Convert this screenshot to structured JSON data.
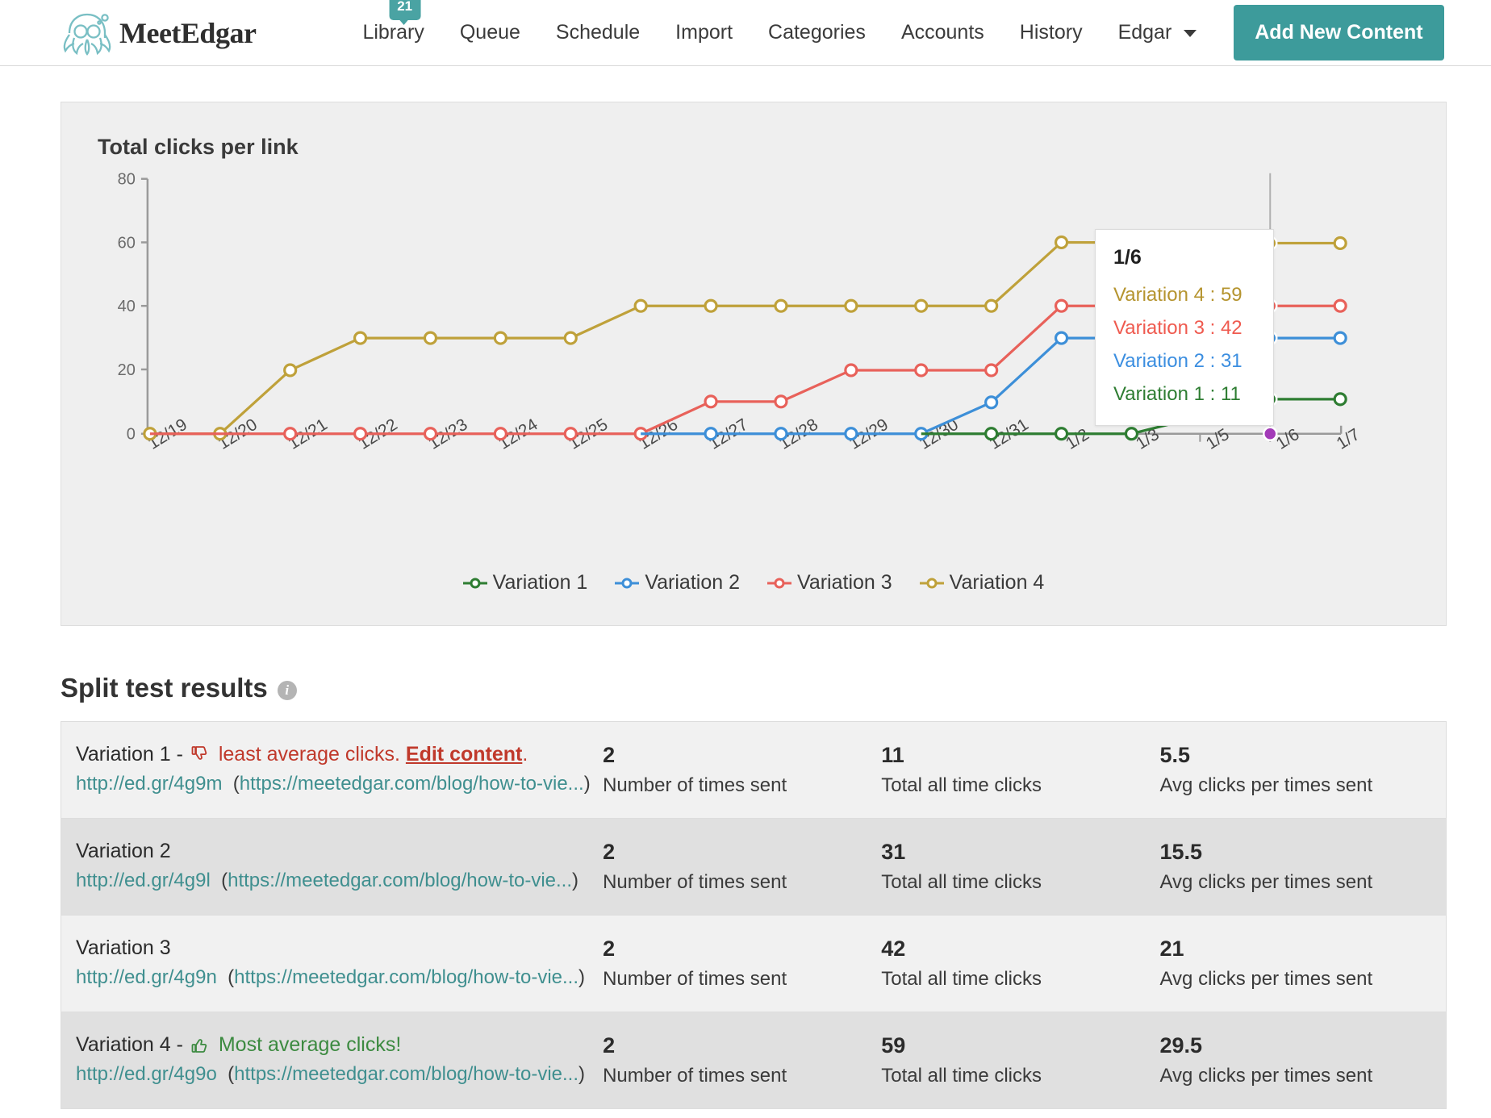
{
  "brand": {
    "name": "MeetEdgar",
    "logo_icon": "octopus-glasses-icon",
    "accent": "#3d9b9b"
  },
  "nav": {
    "items": [
      {
        "label": "Library",
        "badge": "21"
      },
      {
        "label": "Queue"
      },
      {
        "label": "Schedule"
      },
      {
        "label": "Import"
      },
      {
        "label": "Categories"
      },
      {
        "label": "Accounts"
      },
      {
        "label": "History"
      },
      {
        "label": "Edgar",
        "caret": true
      }
    ],
    "cta": "Add New Content"
  },
  "chart_card": {
    "title": "Total clicks per link"
  },
  "chart_data": {
    "type": "line",
    "title": "Total clicks per link",
    "xlabel": "",
    "ylabel": "",
    "ylim": [
      0,
      80
    ],
    "yticks": [
      0,
      20,
      40,
      60,
      80
    ],
    "grid": false,
    "legend_position": "bottom",
    "categories": [
      "12/19",
      "12/20",
      "12/21",
      "12/22",
      "12/23",
      "12/24",
      "12/25",
      "12/26",
      "12/27",
      "12/28",
      "12/29",
      "12/30",
      "12/31",
      "1/2",
      "1/3",
      "1/5",
      "1/6",
      "1/7"
    ],
    "series": [
      {
        "name": "Variation 1",
        "color": "#2e7d32",
        "values": [
          0,
          0,
          0,
          0,
          0,
          0,
          0,
          0,
          0,
          0,
          0,
          0,
          0,
          0,
          0,
          null,
          11,
          11
        ]
      },
      {
        "name": "Variation 2",
        "color": "#3d8fd8",
        "values": [
          0,
          0,
          0,
          0,
          0,
          0,
          0,
          0,
          0,
          0,
          0,
          0,
          10,
          30,
          null,
          null,
          31,
          31
        ]
      },
      {
        "name": "Variation 3",
        "color": "#e8615a",
        "values": [
          0,
          0,
          0,
          0,
          0,
          0,
          0,
          0,
          10,
          10,
          20,
          20,
          20,
          40,
          null,
          null,
          42,
          42
        ]
      },
      {
        "name": "Variation 4",
        "color": "#bfa13a",
        "values": [
          0,
          0,
          20,
          30,
          30,
          30,
          30,
          40,
          40,
          40,
          40,
          40,
          40,
          60,
          null,
          null,
          59,
          59
        ]
      }
    ],
    "tooltip": {
      "date": "1/6",
      "rows": [
        {
          "label": "Variation 4 : 59",
          "color": "#b5942f"
        },
        {
          "label": "Variation 3 : 42",
          "color": "#ef5a4f"
        },
        {
          "label": "Variation 2 : 31",
          "color": "#3b8ee0"
        },
        {
          "label": "Variation 1 : 11",
          "color": "#2e7d32"
        }
      ]
    },
    "legend": [
      {
        "label": "Variation 1",
        "color": "#2e7d32"
      },
      {
        "label": "Variation 2",
        "color": "#3d8fd8"
      },
      {
        "label": "Variation 3",
        "color": "#e8615a"
      },
      {
        "label": "Variation 4",
        "color": "#bfa13a"
      }
    ]
  },
  "split_test": {
    "heading": "Split test results",
    "info_icon": "info-icon",
    "columns": {
      "sent": "Number of times sent",
      "clicks": "Total all time clicks",
      "avg": "Avg clicks per times sent"
    },
    "rows": [
      {
        "name": "Variation 1 -",
        "tag": "least average clicks.",
        "tag_type": "bad",
        "tag_icon": "thumbs-down-icon",
        "edit_link": "Edit content",
        "edit_suffix": ".",
        "short_url": "http://ed.gr/4g9m",
        "long_url": "https://meetedgar.com/blog/how-to-vie...",
        "sent": "2",
        "clicks": "11",
        "avg": "5.5"
      },
      {
        "name": "Variation 2",
        "tag": "",
        "tag_type": "none",
        "short_url": "http://ed.gr/4g9l",
        "long_url": "https://meetedgar.com/blog/how-to-vie...",
        "sent": "2",
        "clicks": "31",
        "avg": "15.5"
      },
      {
        "name": "Variation 3",
        "tag": "",
        "tag_type": "none",
        "short_url": "http://ed.gr/4g9n",
        "long_url": "https://meetedgar.com/blog/how-to-vie...",
        "sent": "2",
        "clicks": "42",
        "avg": "21"
      },
      {
        "name": "Variation 4 -",
        "tag": "Most average clicks!",
        "tag_type": "good",
        "tag_icon": "thumbs-up-icon",
        "short_url": "http://ed.gr/4g9o",
        "long_url": "https://meetedgar.com/blog/how-to-vie...",
        "sent": "2",
        "clicks": "59",
        "avg": "29.5"
      }
    ]
  }
}
